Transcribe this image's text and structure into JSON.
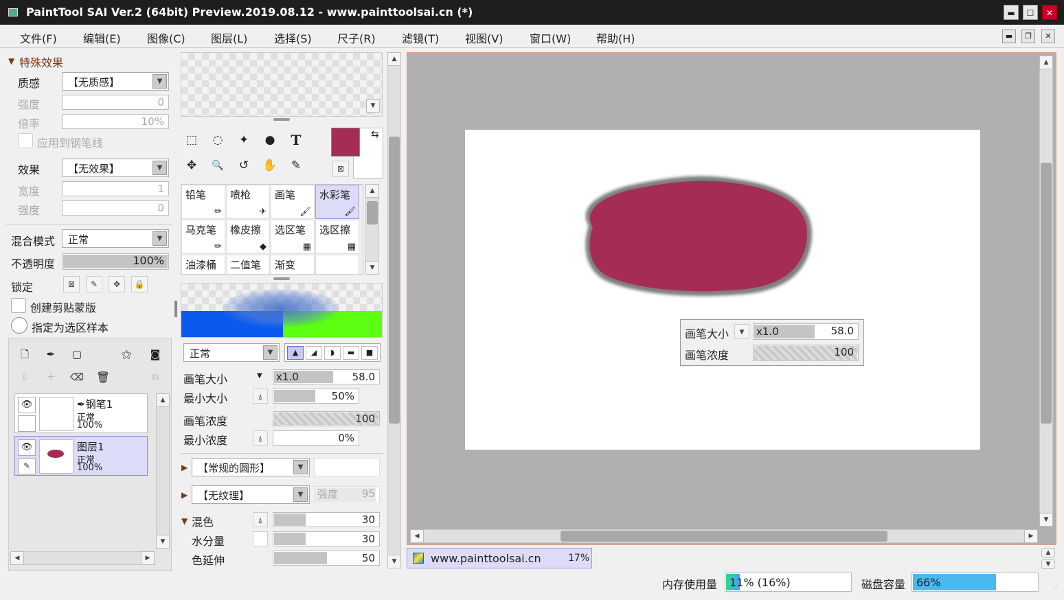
{
  "title": "PaintTool SAI Ver.2 (64bit) Preview.2019.08.12 - www.painttoolsai.cn (*)",
  "window": {
    "min": "▬",
    "max": "☐",
    "close": "✕"
  },
  "menu": [
    "文件(F)",
    "编辑(E)",
    "图像(C)",
    "图层(L)",
    "选择(S)",
    "尺子(R)",
    "滤镜(T)",
    "视图(V)",
    "窗口(W)",
    "帮助(H)"
  ],
  "mdi": {
    "min": "▬",
    "restore": "❐",
    "close": "✕"
  },
  "effects": {
    "section": "特殊效果",
    "texture_label": "质感",
    "texture_value": "【无质感】",
    "strength_label": "强度",
    "strength_value": "0",
    "scale_label": "倍率",
    "scale_value": "10%",
    "apply_pen": "应用到钢笔线",
    "effect_label": "效果",
    "effect_value": "【无效果】",
    "width_label": "宽度",
    "width_value": "1",
    "strength2_label": "强度",
    "strength2_value": "0"
  },
  "layer_props": {
    "blend_label": "混合模式",
    "blend_value": "正常",
    "opacity_label": "不透明度",
    "opacity_value": "100%",
    "lock_label": "锁定",
    "clip": "创建剪贴蒙版",
    "sample": "指定为选区样本"
  },
  "layers": [
    {
      "name": "钢笔1",
      "prefix": "✒",
      "mode": "正常",
      "opacity": "100%"
    },
    {
      "name": "图层1",
      "prefix": "",
      "mode": "正常",
      "opacity": "100%"
    }
  ],
  "tools": {
    "row1": [
      "⬚",
      "◌",
      "✦",
      "●",
      "T"
    ],
    "row2": [
      "✥",
      "🔍",
      "↺",
      "✋",
      "✎"
    ]
  },
  "brushes": [
    {
      "name": "铅笔",
      "icon": "✏",
      "selected": false
    },
    {
      "name": "喷枪",
      "icon": "✈",
      "selected": false
    },
    {
      "name": "画笔",
      "icon": "🖌",
      "selected": false
    },
    {
      "name": "水彩笔",
      "icon": "🖌",
      "selected": true
    },
    {
      "name": "马克笔",
      "icon": "✏",
      "selected": false
    },
    {
      "name": "橡皮擦",
      "icon": "◆",
      "selected": false
    },
    {
      "name": "选区笔",
      "icon": "▦",
      "selected": false
    },
    {
      "name": "选区擦",
      "icon": "▦",
      "selected": false
    },
    {
      "name": "油漆桶",
      "icon": "",
      "selected": false
    },
    {
      "name": "二值笔",
      "icon": "",
      "selected": false
    },
    {
      "name": "渐变",
      "icon": "",
      "selected": false
    },
    {
      "name": "",
      "icon": "",
      "selected": false
    }
  ],
  "colors": {
    "primary": "#a42c55",
    "secondary": "#ffffff",
    "blob": "#a42c55",
    "blue": "#0a5af0",
    "green": "#5cff10"
  },
  "brush_settings": {
    "mode": "正常",
    "size_label": "画笔大小",
    "size_mult": "x1.0",
    "size_value": "58.0",
    "minsize_label": "最小大小",
    "minsize_value": "50%",
    "density_label": "画笔浓度",
    "density_value": "100",
    "mindensity_label": "最小浓度",
    "mindensity_value": "0%",
    "shape": "【常规的圆形】",
    "texture": "【无纹理】",
    "texture_strength_label": "强度",
    "texture_strength_value": "95",
    "mix_label": "混色",
    "mix_value": "30",
    "water_label": "水分量",
    "water_value": "30",
    "extend_label": "色延伸",
    "extend_value": "50"
  },
  "popup": {
    "size_label": "画笔大小",
    "size_mult": "x1.0",
    "size_value": "58.0",
    "density_label": "画笔浓度",
    "density_value": "100"
  },
  "doc_tab": {
    "name": "www.painttoolsai.cn",
    "zoom": "17%"
  },
  "status": {
    "mem_label": "内存使用量",
    "mem_value": "11% (16%)",
    "mem_fraction": 0.11,
    "disk_label": "磁盘容量",
    "disk_value": "66%",
    "disk_fraction": 0.66
  }
}
